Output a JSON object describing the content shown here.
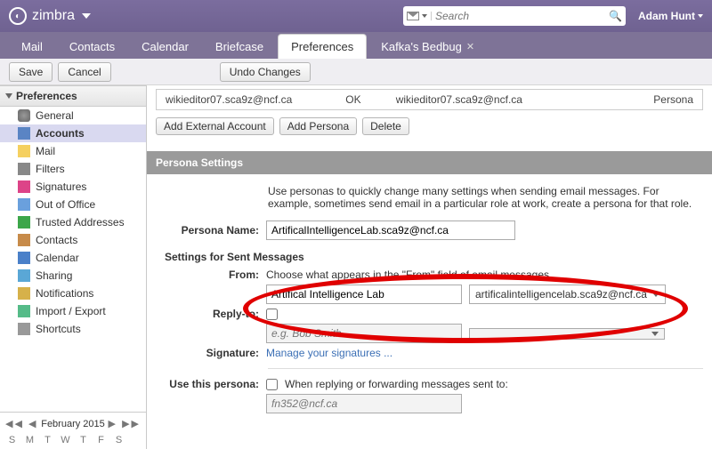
{
  "header": {
    "brand": "zimbra",
    "search_placeholder": "Search",
    "search_scope_icon": "mail-icon",
    "user": "Adam Hunt"
  },
  "tabs": {
    "items": [
      "Mail",
      "Contacts",
      "Calendar",
      "Briefcase",
      "Preferences"
    ],
    "active": "Preferences",
    "extra": {
      "label": "Kafka's Bedbug"
    }
  },
  "toolbar": {
    "save": "Save",
    "cancel": "Cancel",
    "undo": "Undo Changes"
  },
  "sidebar": {
    "head": "Preferences",
    "items": [
      {
        "label": "General",
        "icon": "ic-gear"
      },
      {
        "label": "Accounts",
        "icon": "ic-user"
      },
      {
        "label": "Mail",
        "icon": "ic-mail"
      },
      {
        "label": "Filters",
        "icon": "ic-filter"
      },
      {
        "label": "Signatures",
        "icon": "ic-sig"
      },
      {
        "label": "Out of Office",
        "icon": "ic-ooo"
      },
      {
        "label": "Trusted Addresses",
        "icon": "ic-trust"
      },
      {
        "label": "Contacts",
        "icon": "ic-cont"
      },
      {
        "label": "Calendar",
        "icon": "ic-cal"
      },
      {
        "label": "Sharing",
        "icon": "ic-share"
      },
      {
        "label": "Notifications",
        "icon": "ic-notif"
      },
      {
        "label": "Import / Export",
        "icon": "ic-ie"
      },
      {
        "label": "Shortcuts",
        "icon": "ic-short"
      }
    ],
    "selected": 1
  },
  "minical": {
    "month": "February 2015",
    "days": [
      "S",
      "M",
      "T",
      "W",
      "T",
      "F",
      "S"
    ]
  },
  "accounts": {
    "row": {
      "name": "wikieditor07.sca9z@ncf.ca",
      "status": "OK",
      "email": "wikieditor07.sca9z@ncf.ca",
      "type": "Persona"
    },
    "buttons": {
      "add_ext": "Add External Account",
      "add_persona": "Add Persona",
      "delete": "Delete"
    }
  },
  "persona": {
    "section": "Persona Settings",
    "help": "Use personas to quickly change many settings when sending email messages. For example, sometimes send email in a particular role at work, create a persona for that role.",
    "name_label": "Persona Name:",
    "name_value": "ArtificalIntelligenceLab.sca9z@ncf.ca",
    "sent_head": "Settings for Sent Messages",
    "from_label": "From:",
    "from_desc": "Choose what appears in the \"From\" field of email messages",
    "from_name": "Artifical Intelligence Lab",
    "from_email": "artificalintelligencelab.sca9z@ncf.ca",
    "reply_label": "Reply-to:",
    "reply_placeholder": "e.g. Bob Smith",
    "sig_label": "Signature:",
    "sig_link": "Manage your signatures ...",
    "use_label": "Use this persona:",
    "use_desc": "When replying or forwarding messages sent to:",
    "use_placeholder": "fn352@ncf.ca"
  },
  "annotation": {
    "oval_color": "#e00000"
  }
}
